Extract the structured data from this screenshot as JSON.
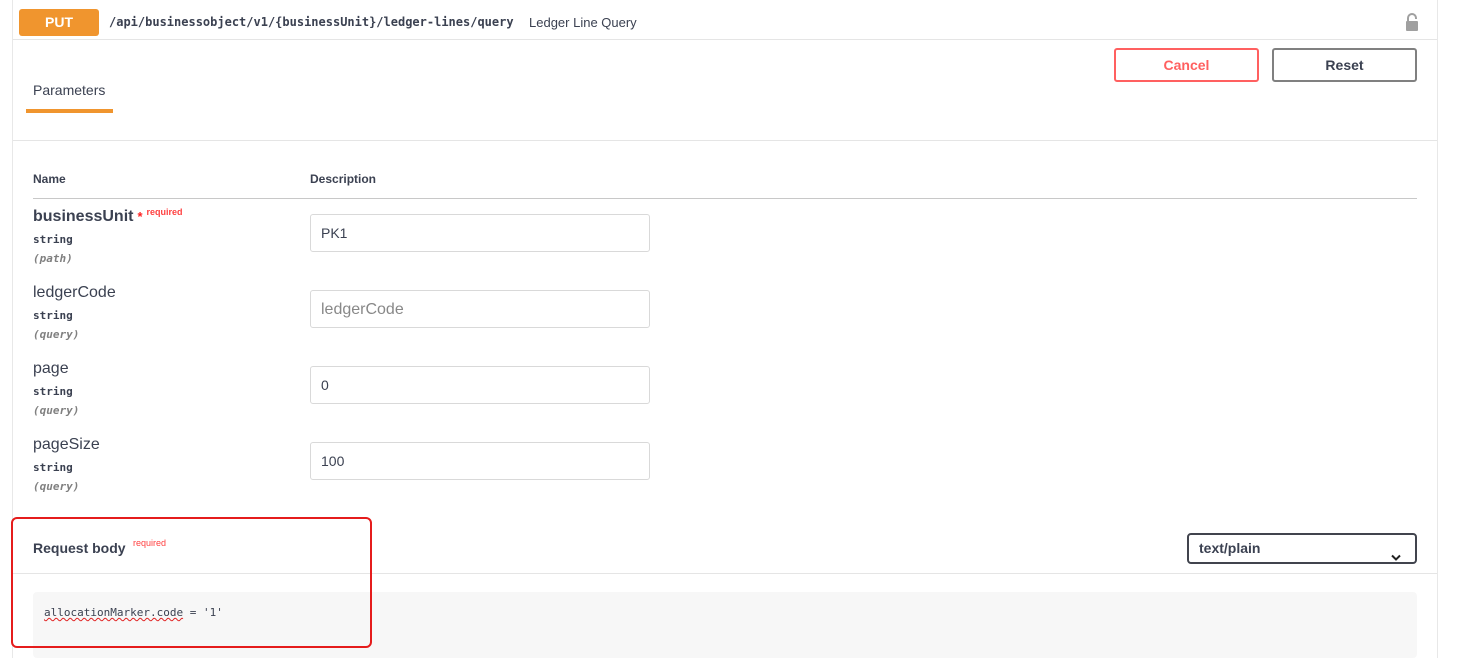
{
  "summary": {
    "method": "PUT",
    "path": "/api/businessobject/v1/{businessUnit}/ledger-lines/query",
    "description": "Ledger Line Query"
  },
  "tabs": {
    "parameters": "Parameters"
  },
  "buttons": {
    "cancel": "Cancel",
    "reset": "Reset"
  },
  "table": {
    "name_header": "Name",
    "description_header": "Description"
  },
  "params": [
    {
      "name": "businessUnit",
      "required_star": "*",
      "required_label": "required",
      "type": "string",
      "in": "(path)",
      "value": "PK1",
      "placeholder": ""
    },
    {
      "name": "ledgerCode",
      "type": "string",
      "in": "(query)",
      "value": "",
      "placeholder": "ledgerCode"
    },
    {
      "name": "page",
      "type": "string",
      "in": "(query)",
      "value": "0",
      "placeholder": ""
    },
    {
      "name": "pageSize",
      "type": "string",
      "in": "(query)",
      "value": "100",
      "placeholder": ""
    }
  ],
  "request_body": {
    "title": "Request body",
    "required_label": "required",
    "content_type": "text/plain",
    "code_underlined": "allocationMarker.code",
    "code_rest": " = '1'"
  },
  "colors": {
    "method_put": "#f0952e",
    "cancel_red": "#ff6060",
    "required_red": "#ff4040",
    "highlight_red": "#e51c1c"
  },
  "icons": {
    "lock": "lock-icon",
    "chevron": "chevron-down-icon"
  }
}
